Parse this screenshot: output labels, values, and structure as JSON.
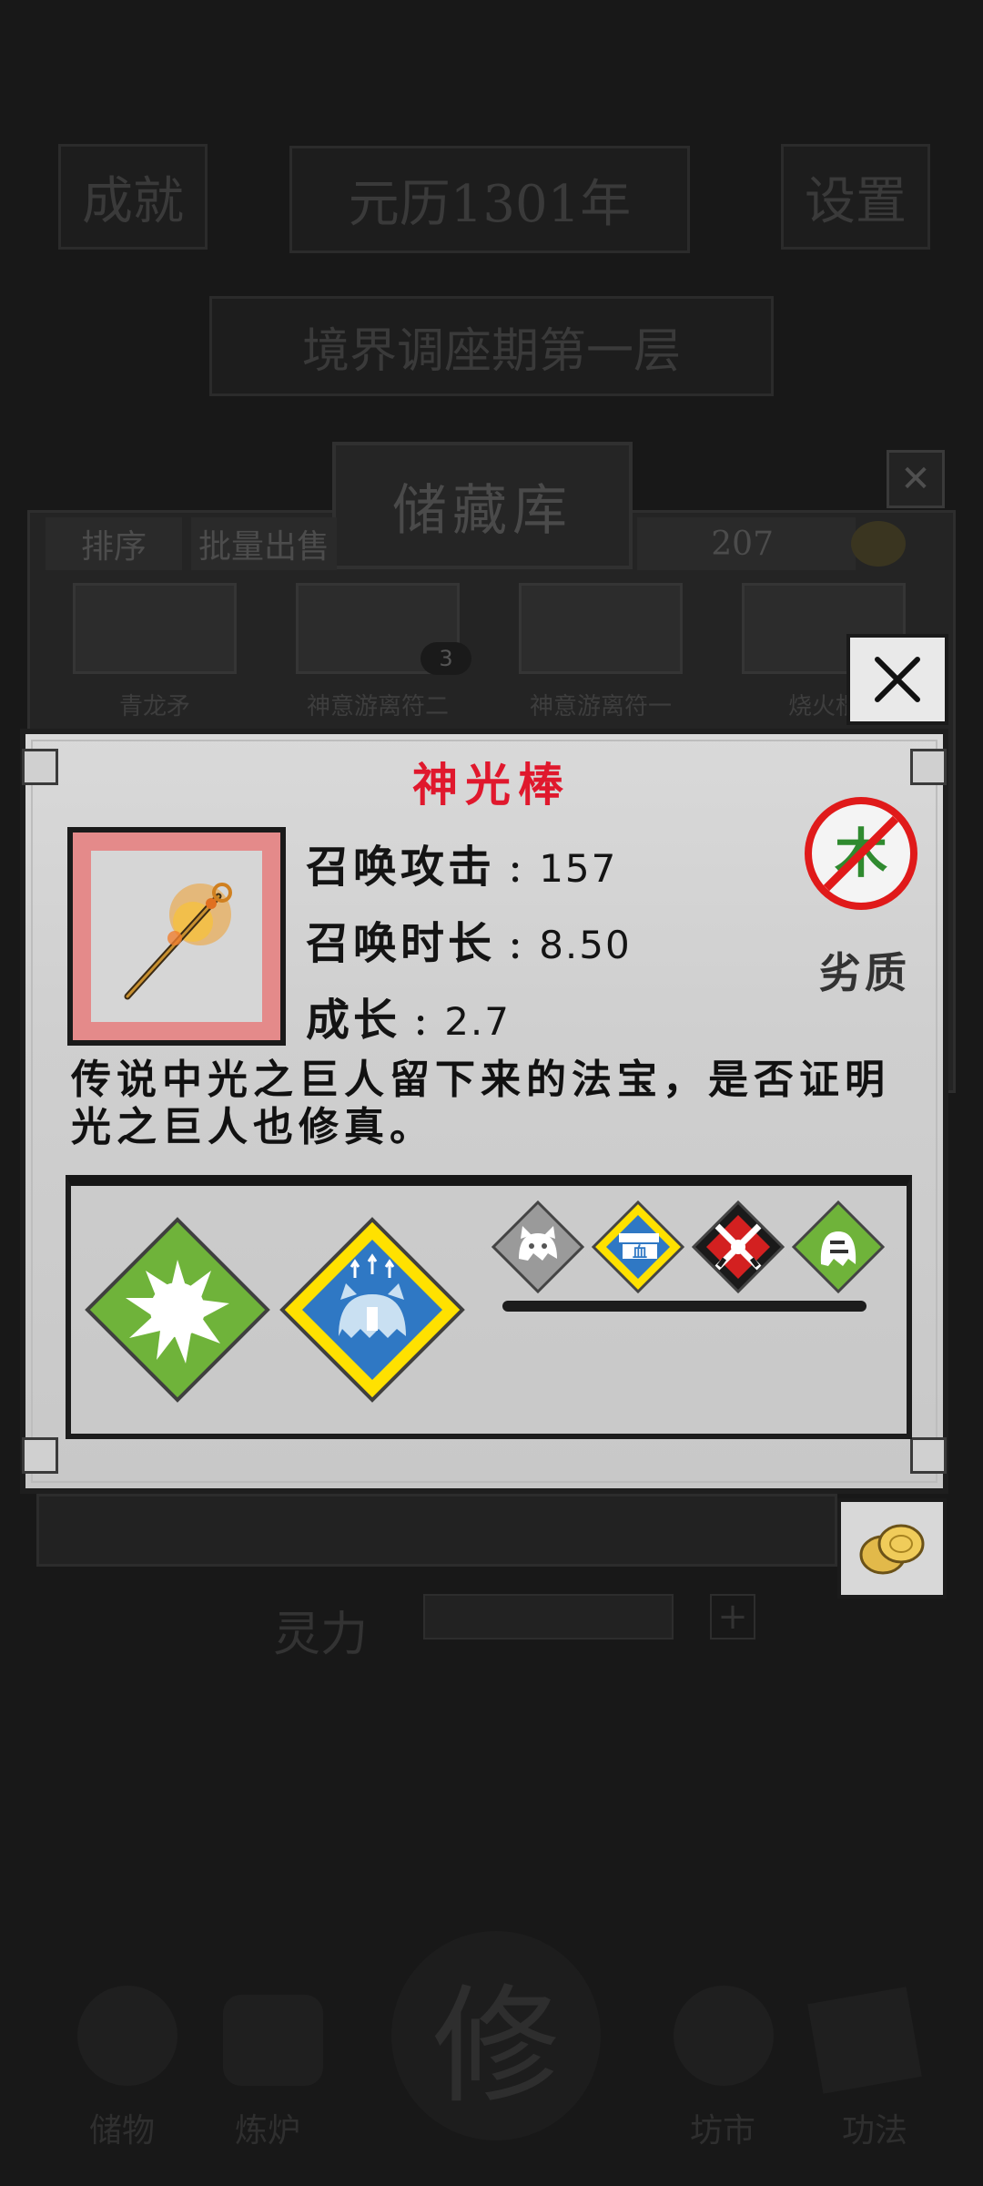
{
  "background": {
    "top_left_button": "成就",
    "year_banner": "元历1301年",
    "top_right_button": "设置",
    "realm_banner": "境界调座期第一层",
    "storage": {
      "title": "储藏库",
      "sort_label": "排序",
      "batch_sell_label": "批量出售",
      "count": "207",
      "slots": [
        {
          "label": "青龙矛"
        },
        {
          "label": "神意游离符二"
        },
        {
          "label": "神意游离符一"
        },
        {
          "label": "烧火棍"
        }
      ],
      "stack_count": "3"
    },
    "power_label": "灵力",
    "bottom_nav": [
      {
        "label": "储物"
      },
      {
        "label": "炼炉"
      },
      {
        "label": "修"
      },
      {
        "label": "坊市"
      },
      {
        "label": "功法"
      }
    ]
  },
  "item": {
    "name": "神光棒",
    "stats": [
      {
        "label": "召唤攻击",
        "value": "157"
      },
      {
        "label": "召唤时长",
        "value": "8.50"
      },
      {
        "label": "成长",
        "value": "2.7"
      }
    ],
    "element_icon": "wood-element-badge",
    "element_char": "木",
    "quality": "劣质",
    "description": "传说中光之巨人留下来的法宝，是否证明光之巨人也修真。",
    "skills_big": [
      {
        "icon": "burst-skill-icon",
        "color": "#6fb33a"
      },
      {
        "icon": "ghost-attack-up-skill-icon",
        "color": "#2f78c4"
      }
    ],
    "skills_small": [
      {
        "icon": "ghost-cat-icon",
        "color": "#8a8a8a"
      },
      {
        "icon": "blood-hat-icon",
        "color": "#2f78c4"
      },
      {
        "icon": "crossed-swords-icon",
        "color": "#d32020"
      },
      {
        "icon": "green-ghost-icon",
        "color": "#6fb33a"
      }
    ]
  },
  "colors": {
    "name_red": "#e0182d",
    "frame_red": "#e48a8a"
  }
}
